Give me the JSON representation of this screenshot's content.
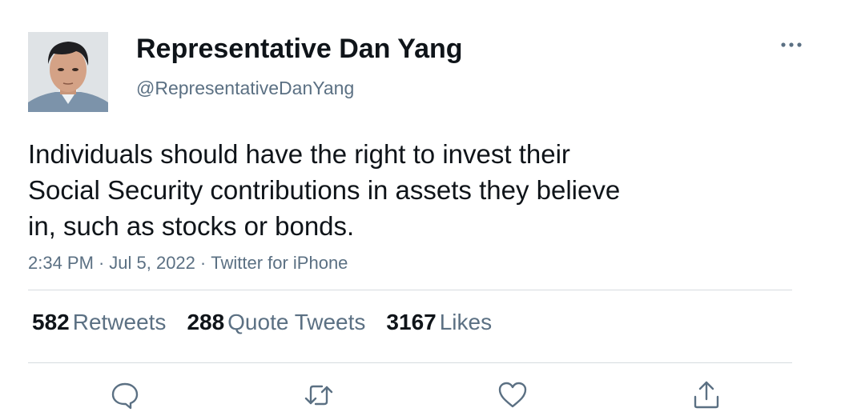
{
  "author": {
    "display_name": "Representative Dan Yang",
    "handle": "@RepresentativeDanYang"
  },
  "tweet": {
    "text_lines": [
      "Individuals should have the right to invest their",
      "Social Security contributions in assets they believe",
      "in, such as stocks or bonds."
    ],
    "time": "2:34 PM",
    "separator": "·",
    "date": "Jul 5, 2022",
    "source": "Twitter for iPhone"
  },
  "stats": {
    "retweets": {
      "count": "582",
      "label": "Retweets"
    },
    "quotes": {
      "count": "288",
      "label": "Quote Tweets"
    },
    "likes": {
      "count": "3167",
      "label": "Likes"
    }
  },
  "icons": {
    "more": "more-icon",
    "reply": "reply-icon",
    "retweet": "retweet-icon",
    "like": "like-icon",
    "share": "share-icon"
  },
  "colors": {
    "text": "#0f1419",
    "secondary": "#5b7083",
    "divider": "#d6dbdf",
    "background": "#ffffff"
  }
}
